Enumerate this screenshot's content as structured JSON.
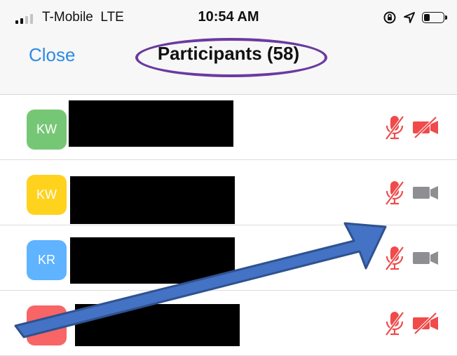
{
  "status_bar": {
    "carrier": "T-Mobile",
    "network": "LTE",
    "time": "10:54 AM",
    "icons": [
      "signal-icon",
      "rotation-lock-icon",
      "location-icon",
      "battery-icon"
    ],
    "battery_level": 0.35
  },
  "nav": {
    "close_label": "Close",
    "title": "Participants (58)"
  },
  "colors": {
    "accent_blue": "#2d8ae6",
    "muted_red": "#f04a4a",
    "video_on_gray": "#8e8e93",
    "annotation_purple": "#6b3aa0",
    "annotation_arrow_blue": "#4472c4"
  },
  "participants": [
    {
      "initials": "KW",
      "avatar_color": "#76c775",
      "mic": "muted",
      "video": "off"
    },
    {
      "initials": "KW",
      "avatar_color": "#ffd21e",
      "mic": "muted",
      "video": "on"
    },
    {
      "initials": "KR",
      "avatar_color": "#5fb3ff",
      "mic": "muted",
      "video": "on"
    },
    {
      "initials": "KM",
      "avatar_color": "#f76566",
      "mic": "muted",
      "video": "off"
    }
  ]
}
